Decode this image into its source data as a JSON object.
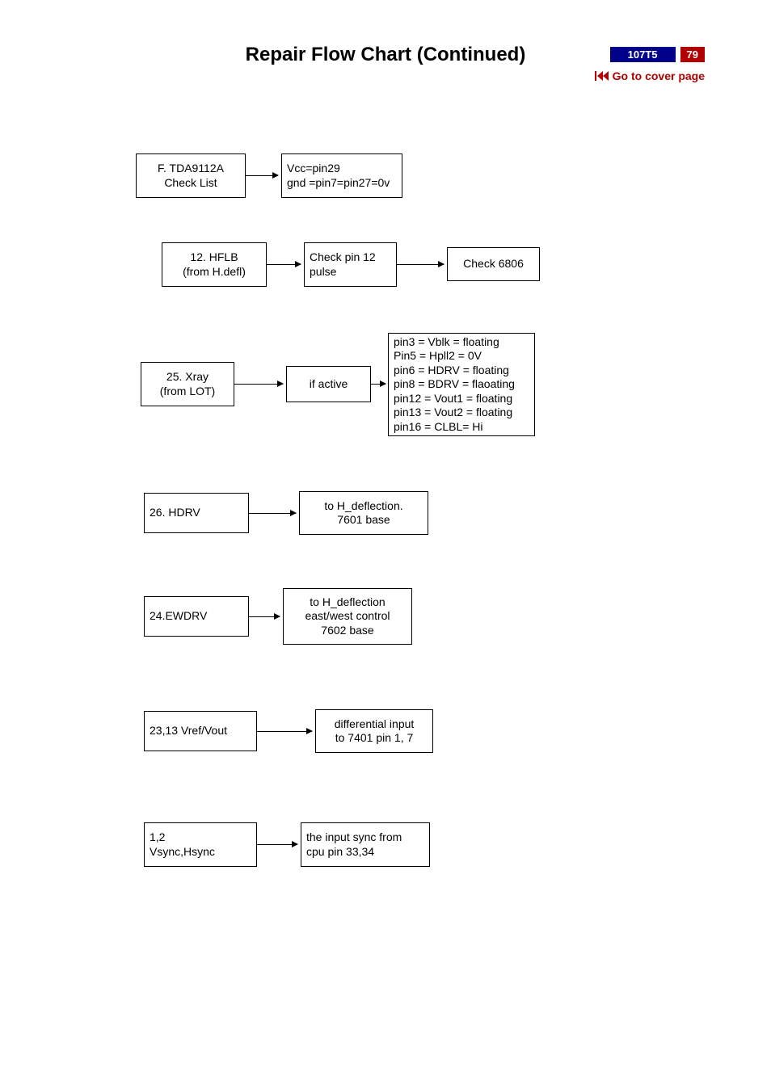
{
  "header": {
    "title": "Repair Flow Chart (Continued)",
    "model": "107T5",
    "page": "79",
    "cover_link": "Go to cover page"
  },
  "rows": {
    "r1": {
      "a_line1": "F. TDA9112A",
      "a_line2": "Check List",
      "b_line1": "Vcc=pin29",
      "b_line2": "gnd =pin7=pin27=0v"
    },
    "r2": {
      "a_line1": "12. HFLB",
      "a_line2": "(from H.defl)",
      "b_line1": "Check pin 12",
      "b_line2": "pulse",
      "c": "Check 6806"
    },
    "r3": {
      "a_line1": "25. Xray",
      "a_line2": "(from LOT)",
      "b": "if active",
      "c_lines": [
        "pin3 = Vblk = floating",
        "Pin5 = Hpll2 = 0V",
        "pin6  =  HDRV = floating",
        "pin8  =  BDRV = flaoating",
        "pin12 = Vout1 = floating",
        "pin13 = Vout2 = floating",
        "pin16 = CLBL= Hi"
      ]
    },
    "r4": {
      "a": "26. HDRV",
      "b_line1": "to H_deflection.",
      "b_line2": "7601 base"
    },
    "r5": {
      "a": "24.EWDRV",
      "b_line1": "to H_deflection",
      "b_line2": "east/west control",
      "b_line3": "7602  base"
    },
    "r6": {
      "a": "23,13 Vref/Vout",
      "b_line1": "differential input",
      "b_line2": "to 7401 pin 1, 7"
    },
    "r7": {
      "a_line1": "1,2",
      "a_line2": "Vsync,Hsync",
      "b_line1": "the input sync from",
      "b_line2": "cpu pin 33,34"
    }
  }
}
